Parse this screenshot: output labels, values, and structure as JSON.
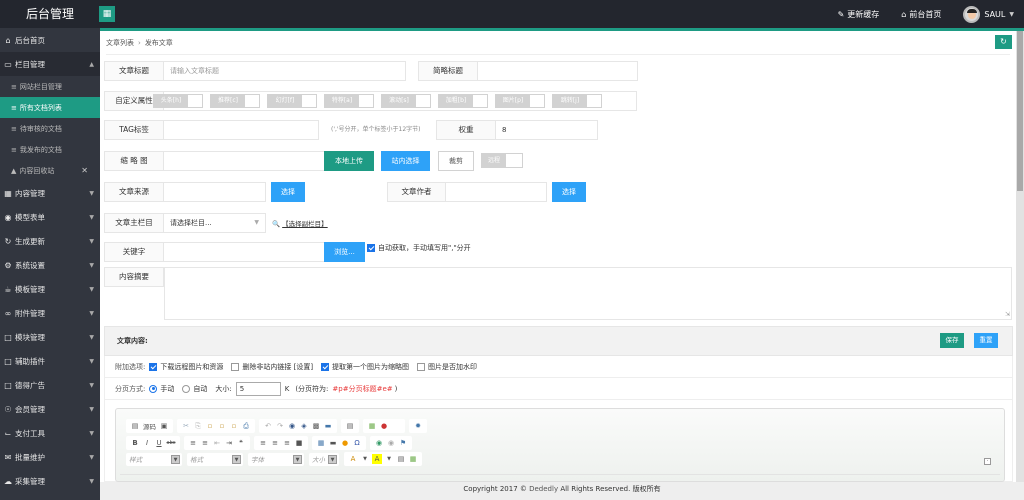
{
  "app": {
    "title": "后台管理",
    "menu_toggle_icon": "grid-icon"
  },
  "topnav": {
    "refresh_cache": "更新缓存",
    "frontend_home": "前台首页",
    "username": "SAUL"
  },
  "sidebar": {
    "items": [
      {
        "label": "后台首页",
        "icon": "home-icon"
      },
      {
        "label": "栏目管理",
        "icon": "monitor-icon",
        "open": true
      },
      {
        "label": "内容管理",
        "icon": "grid-icon"
      },
      {
        "label": "模型表单",
        "icon": "globe-icon"
      },
      {
        "label": "生成更新",
        "icon": "refresh-icon"
      },
      {
        "label": "系统设置",
        "icon": "gear-icon"
      },
      {
        "label": "模板管理",
        "icon": "cup-icon"
      },
      {
        "label": "附件管理",
        "icon": "paperclip-icon"
      },
      {
        "label": "模块管理",
        "icon": "folder-icon"
      },
      {
        "label": "辅助插件",
        "icon": "folder-icon"
      },
      {
        "label": "德得广告",
        "icon": "folder-icon"
      },
      {
        "label": "会员管理",
        "icon": "user-circle-icon"
      },
      {
        "label": "支付工具",
        "icon": "cart-icon"
      },
      {
        "label": "批量维护",
        "icon": "mail-icon"
      },
      {
        "label": "采集管理",
        "icon": "cloud-icon"
      }
    ],
    "sub_items": [
      {
        "label": "网站栏目管理",
        "active": false
      },
      {
        "label": "所有文档列表",
        "active": true
      },
      {
        "label": "待审核的文档",
        "active": false
      },
      {
        "label": "我发布的文档",
        "active": false
      },
      {
        "label": "内容回收站",
        "active": false
      }
    ]
  },
  "breadcrumb": {
    "parent": "文章列表",
    "current": "发布文章"
  },
  "form": {
    "title_label": "文章标题",
    "title_placeholder": "请输入文章标题",
    "short_title_label": "简略标题",
    "short_title_value": "",
    "attr_label": "自定义属性",
    "attrs": [
      "头条[h]",
      "推荐[c]",
      "幻灯[f]",
      "特荐[a]",
      "滚动[s]",
      "加粗[b]",
      "图片[p]",
      "跳转[j]"
    ],
    "tag_label": "TAG标签",
    "tag_value": "",
    "tag_hint": "(','号分开，单个标签小于12字节)",
    "weight_label": "权重",
    "weight_value": "8",
    "thumb_label": "缩 略 图",
    "thumb_value": "",
    "local_upload": "本地上传",
    "site_select": "站内选择",
    "crop": "裁剪",
    "remote": "远程",
    "source_label": "文章来源",
    "source_value": "",
    "source_select": "选择",
    "author_label": "文章作者",
    "author_value": "",
    "author_select": "选择",
    "column_label": "文章主栏目",
    "column_value": "请选择栏目...",
    "sub_column_link": "【选择副栏目】",
    "keyword_label": "关键字",
    "keyword_value": "",
    "browse": "浏览...",
    "auto_keyword": "自动获取，手动填写用\",\"分开",
    "auto_keyword_checked": true,
    "summary_label": "内容摘要",
    "summary_value": ""
  },
  "content": {
    "title": "文章内容:",
    "save": "保存",
    "reset": "重置",
    "options_label": "附加选项:",
    "options": [
      {
        "label": "下载远程图片和资源",
        "checked": true
      },
      {
        "label": "删除非站内链接 [设置]",
        "checked": false
      },
      {
        "label": "提取第一个图片为缩略图",
        "checked": true
      },
      {
        "label": "图片是否加水印",
        "checked": false
      }
    ],
    "paging_label": "分页方式:",
    "paging_manual": "手动",
    "paging_auto": "自动",
    "paging_selected": "手动",
    "size_label": "大小:",
    "size_value": "5",
    "size_unit": "K",
    "separator_prefix": "(分页符为:",
    "separator_code": "#p#分页标题#e#",
    "separator_suffix": ")"
  },
  "editor": {
    "source_label": "源码",
    "combos": [
      "样式",
      "格式",
      "字体",
      "大小"
    ]
  },
  "footer": {
    "text_prefix": "Copyright 2017 ©",
    "brand": "Dededly",
    "text_suffix": "All Rights Reserved. 版权所有"
  },
  "colors": {
    "accent": "#1e9b84",
    "blue": "#2ea2f8",
    "sidebar": "#32363f",
    "topbar": "#23262e",
    "red": "#e83b3b"
  }
}
